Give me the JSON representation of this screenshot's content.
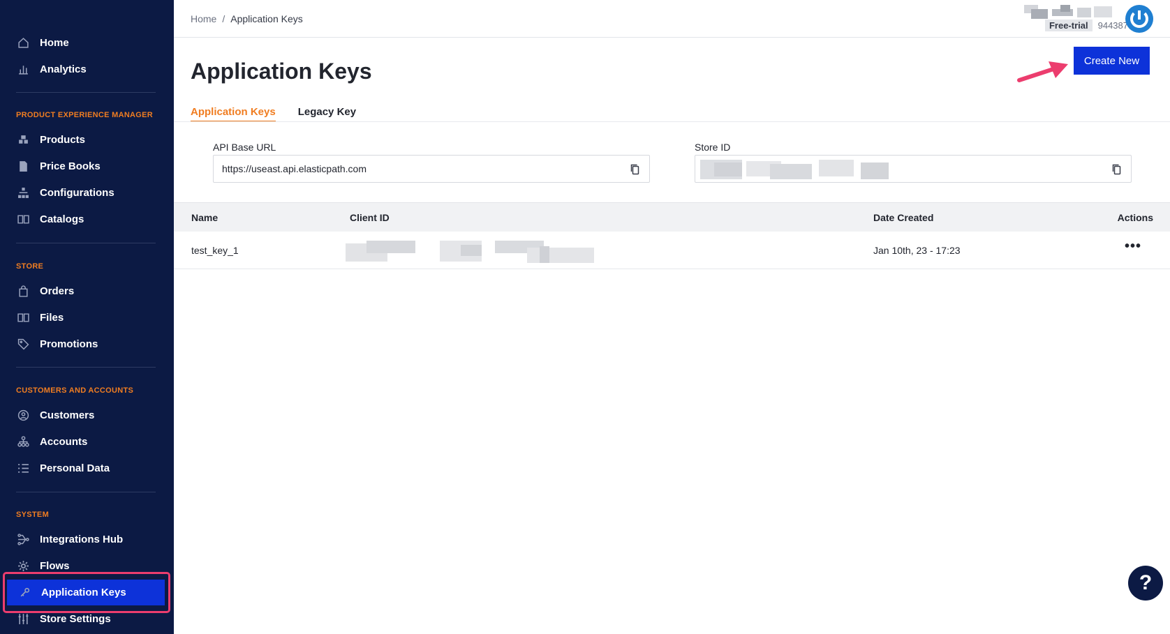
{
  "sidebar": {
    "top_items": [
      {
        "label": "Home",
        "icon": "home-icon"
      },
      {
        "label": "Analytics",
        "icon": "analytics-icon"
      }
    ],
    "sections": [
      {
        "title": "PRODUCT EXPERIENCE MANAGER",
        "items": [
          {
            "label": "Products",
            "icon": "products-icon"
          },
          {
            "label": "Price Books",
            "icon": "price-books-icon"
          },
          {
            "label": "Configurations",
            "icon": "configurations-icon"
          },
          {
            "label": "Catalogs",
            "icon": "catalogs-icon"
          }
        ]
      },
      {
        "title": "STORE",
        "items": [
          {
            "label": "Orders",
            "icon": "orders-icon"
          },
          {
            "label": "Files",
            "icon": "files-icon"
          },
          {
            "label": "Promotions",
            "icon": "tag-icon"
          }
        ]
      },
      {
        "title": "CUSTOMERS AND ACCOUNTS",
        "items": [
          {
            "label": "Customers",
            "icon": "customer-icon"
          },
          {
            "label": "Accounts",
            "icon": "accounts-icon"
          },
          {
            "label": "Personal Data",
            "icon": "list-icon"
          }
        ]
      },
      {
        "title": "SYSTEM",
        "items": [
          {
            "label": "Integrations Hub",
            "icon": "integrations-icon"
          },
          {
            "label": "Flows",
            "icon": "gear-icon"
          },
          {
            "label": "Application Keys",
            "icon": "key-icon",
            "active": true
          },
          {
            "label": "Store Settings",
            "icon": "sliders-icon"
          }
        ]
      }
    ]
  },
  "header": {
    "breadcrumb": [
      "Home",
      "Application Keys"
    ],
    "breadcrumb_separator": "/",
    "plan_badge": "Free-trial",
    "account_number": "944387"
  },
  "main": {
    "title": "Application Keys",
    "create_button": "Create New",
    "tabs": [
      {
        "label": "Application Keys",
        "active": true
      },
      {
        "label": "Legacy Key",
        "active": false
      }
    ],
    "api_base_url": {
      "label": "API Base URL",
      "value": "https://useast.api.elasticpath.com"
    },
    "store_id": {
      "label": "Store ID",
      "value": ""
    },
    "table": {
      "columns": [
        "Name",
        "Client ID",
        "Date Created",
        "Actions"
      ],
      "rows": [
        {
          "name": "test_key_1",
          "client_id": "",
          "date_created": "Jan 10th, 23 - 17:23",
          "actions": "•••"
        }
      ]
    }
  },
  "help": {
    "label": "?"
  },
  "colors": {
    "sidebar_bg": "#0c1a44",
    "accent_blue": "#0d32d9",
    "section_orange": "#f07d21",
    "highlight_pink": "#ec3d6e"
  }
}
